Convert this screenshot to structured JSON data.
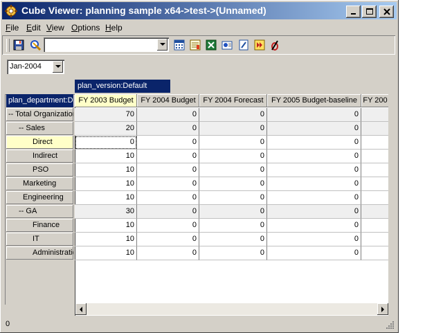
{
  "window": {
    "title": "Cube Viewer: planning sample x64->test->(Unnamed)"
  },
  "titlebar_buttons": [
    "minimize",
    "maximize",
    "close"
  ],
  "menu": [
    {
      "label": "File",
      "mnemonic": "F",
      "rest": "ile"
    },
    {
      "label": "Edit",
      "mnemonic": "E",
      "rest": "dit"
    },
    {
      "label": "View",
      "mnemonic": "V",
      "rest": "iew"
    },
    {
      "label": "Options",
      "mnemonic": "O",
      "rest": "ptions"
    },
    {
      "label": "Help",
      "mnemonic": "H",
      "rest": "elp"
    }
  ],
  "toolbar": {
    "view_combo_value": "",
    "icons": [
      "save-icon",
      "recalculate-icon",
      "calculator-icon",
      "sheet-icon",
      "excel-icon",
      "dimension-icon",
      "notes-icon",
      "forward-icon",
      "pen-icon"
    ]
  },
  "title_dimension": {
    "selected": "Jan-2004"
  },
  "grid": {
    "column_dimension": "plan_version:Default",
    "row_dimension": "plan_department:De",
    "columns": [
      "FY 2003 Budget",
      "FY 2004 Budget",
      "FY 2004 Forecast",
      "FY 2005 Budget-baseline",
      "FY 200"
    ],
    "rows": [
      {
        "label": "-- Total Organization",
        "values": [
          "70",
          "0",
          "0",
          "0",
          ""
        ]
      },
      {
        "label": "-- Sales",
        "values": [
          "20",
          "0",
          "0",
          "0",
          ""
        ]
      },
      {
        "label": "Direct",
        "values": [
          "0",
          "0",
          "0",
          "0",
          ""
        ]
      },
      {
        "label": "Indirect",
        "values": [
          "10",
          "0",
          "0",
          "0",
          ""
        ]
      },
      {
        "label": "PSO",
        "values": [
          "10",
          "0",
          "0",
          "0",
          ""
        ]
      },
      {
        "label": "Marketing",
        "values": [
          "10",
          "0",
          "0",
          "0",
          ""
        ]
      },
      {
        "label": "Engineering",
        "values": [
          "10",
          "0",
          "0",
          "0",
          ""
        ]
      },
      {
        "label": "-- GA",
        "values": [
          "30",
          "0",
          "0",
          "0",
          ""
        ]
      },
      {
        "label": "Finance",
        "values": [
          "10",
          "0",
          "0",
          "0",
          ""
        ]
      },
      {
        "label": "IT",
        "values": [
          "10",
          "0",
          "0",
          "0",
          ""
        ]
      },
      {
        "label": "Administration",
        "values": [
          "10",
          "0",
          "0",
          "0",
          ""
        ]
      }
    ]
  },
  "status": {
    "text": "0"
  },
  "colors": {
    "title_start": "#0a246a",
    "title_end": "#a6caf0",
    "highlight": "#ffffc8"
  }
}
